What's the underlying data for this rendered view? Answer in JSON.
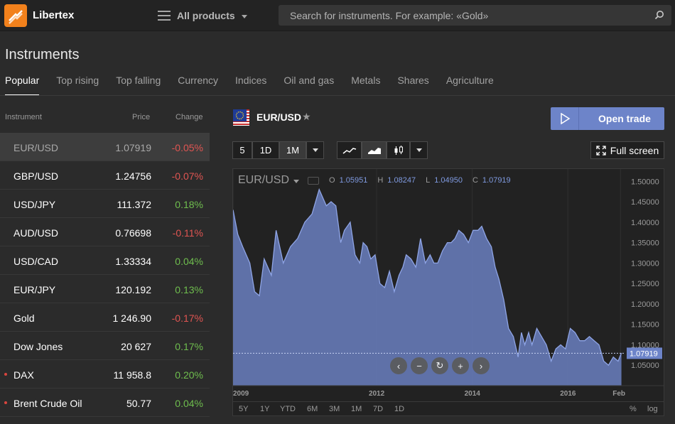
{
  "app": {
    "brand": "Libertex",
    "menu_label": "All products",
    "search_placeholder": "Search for instruments. For example: «Gold»"
  },
  "page": {
    "title": "Instruments",
    "tabs": [
      "Popular",
      "Top rising",
      "Top falling",
      "Currency",
      "Indices",
      "Oil and gas",
      "Metals",
      "Shares",
      "Agriculture"
    ],
    "active_tab": "Popular"
  },
  "table": {
    "headers": {
      "instrument": "Instrument",
      "price": "Price",
      "change": "Change"
    },
    "rows": [
      {
        "name": "EUR/USD",
        "price": "1.07919",
        "change": "-0.05%",
        "direction": "down",
        "selected": true,
        "dot": false
      },
      {
        "name": "GBP/USD",
        "price": "1.24756",
        "change": "-0.07%",
        "direction": "down",
        "selected": false,
        "dot": false
      },
      {
        "name": "USD/JPY",
        "price": "111.372",
        "change": "0.18%",
        "direction": "up",
        "selected": false,
        "dot": false
      },
      {
        "name": "AUD/USD",
        "price": "0.76698",
        "change": "-0.11%",
        "direction": "down",
        "selected": false,
        "dot": false
      },
      {
        "name": "USD/CAD",
        "price": "1.33334",
        "change": "0.04%",
        "direction": "up",
        "selected": false,
        "dot": false
      },
      {
        "name": "EUR/JPY",
        "price": "120.192",
        "change": "0.13%",
        "direction": "up",
        "selected": false,
        "dot": false
      },
      {
        "name": "Gold",
        "price": "1 246.90",
        "change": "-0.17%",
        "direction": "down",
        "selected": false,
        "dot": false
      },
      {
        "name": "Dow Jones",
        "price": "20 627",
        "change": "0.17%",
        "direction": "up",
        "selected": false,
        "dot": false
      },
      {
        "name": "DAX",
        "price": "11 958.8",
        "change": "0.20%",
        "direction": "up",
        "selected": false,
        "dot": true
      },
      {
        "name": "Brent Crude Oil",
        "price": "50.77",
        "change": "0.04%",
        "direction": "up",
        "selected": false,
        "dot": true
      }
    ]
  },
  "instrument": {
    "symbol": "EUR/USD",
    "open_trade_label": "Open trade",
    "full_screen_label": "Full screen",
    "interval_buttons": [
      "5",
      "1D",
      "1M"
    ],
    "active_interval": "1M",
    "chart_type_icons": [
      "line-chart-icon",
      "area-chart-icon",
      "candlestick-icon"
    ],
    "active_chart_type": "area-chart-icon"
  },
  "ohlc": {
    "symbol": "EUR/USD",
    "o_label": "O",
    "o": "1.05951",
    "h_label": "H",
    "h": "1.08247",
    "l_label": "L",
    "l": "1.04950",
    "c_label": "C",
    "c": "1.07919"
  },
  "ranges": [
    "5Y",
    "1Y",
    "YTD",
    "6M",
    "3M",
    "1M",
    "7D",
    "1D"
  ],
  "scale_options": [
    "%",
    "log"
  ],
  "colors": {
    "accent": "#6d84c9",
    "area_fill": "#6a7fbf",
    "area_line": "#8fa5e6",
    "positive": "#6fbe4e",
    "negative": "#e05552",
    "brand": "#f2811c"
  },
  "chart_data": {
    "type": "area",
    "title": "EUR/USD",
    "xlabel": "",
    "ylabel": "",
    "x_tick_labels": [
      "2009",
      "2012",
      "2014",
      "2016",
      "Feb"
    ],
    "x_ticks": [
      2009,
      2012,
      2014,
      2016,
      2017.1
    ],
    "y_ticks": [
      1.05,
      1.1,
      1.15,
      1.2,
      1.25,
      1.3,
      1.35,
      1.4,
      1.45,
      1.5
    ],
    "y_tick_labels": [
      "1.05000",
      "1.10000",
      "1.15000",
      "1.20000",
      "1.25000",
      "1.30000",
      "1.35000",
      "1.40000",
      "1.45000",
      "1.50000"
    ],
    "xlim": [
      2009,
      2017.2
    ],
    "ylim": [
      1.0,
      1.53
    ],
    "current_value": 1.07919,
    "current_label": "1.07919",
    "x": [
      2009.0,
      2009.1,
      2009.2,
      2009.35,
      2009.45,
      2009.55,
      2009.65,
      2009.8,
      2009.9,
      2010.05,
      2010.2,
      2010.35,
      2010.5,
      2010.65,
      2010.8,
      2010.95,
      2011.05,
      2011.15,
      2011.25,
      2011.33,
      2011.45,
      2011.55,
      2011.65,
      2011.72,
      2011.8,
      2011.88,
      2011.97,
      2012.07,
      2012.17,
      2012.27,
      2012.37,
      2012.47,
      2012.55,
      2012.62,
      2012.72,
      2012.82,
      2012.92,
      2013.02,
      2013.12,
      2013.2,
      2013.28,
      2013.38,
      2013.48,
      2013.56,
      2013.64,
      2013.72,
      2013.82,
      2013.92,
      2014.02,
      2014.12,
      2014.2,
      2014.3,
      2014.4,
      2014.48,
      2014.56,
      2014.66,
      2014.76,
      2014.86,
      2014.96,
      2015.03,
      2015.1,
      2015.18,
      2015.25,
      2015.35,
      2015.45,
      2015.55,
      2015.65,
      2015.75,
      2015.85,
      2015.95,
      2016.05,
      2016.15,
      2016.25,
      2016.35,
      2016.45,
      2016.55,
      2016.65,
      2016.75,
      2016.85,
      2016.95,
      2017.05,
      2017.12
    ],
    "y": [
      1.43,
      1.37,
      1.34,
      1.3,
      1.23,
      1.22,
      1.31,
      1.27,
      1.38,
      1.3,
      1.34,
      1.36,
      1.4,
      1.42,
      1.48,
      1.44,
      1.45,
      1.44,
      1.35,
      1.38,
      1.4,
      1.32,
      1.3,
      1.35,
      1.34,
      1.31,
      1.32,
      1.25,
      1.24,
      1.28,
      1.23,
      1.27,
      1.29,
      1.32,
      1.31,
      1.29,
      1.36,
      1.3,
      1.32,
      1.3,
      1.3,
      1.33,
      1.35,
      1.35,
      1.36,
      1.38,
      1.37,
      1.35,
      1.38,
      1.38,
      1.39,
      1.36,
      1.34,
      1.29,
      1.26,
      1.21,
      1.14,
      1.12,
      1.07,
      1.13,
      1.1,
      1.13,
      1.1,
      1.14,
      1.12,
      1.1,
      1.06,
      1.09,
      1.1,
      1.09,
      1.14,
      1.13,
      1.11,
      1.11,
      1.12,
      1.11,
      1.1,
      1.06,
      1.05,
      1.07,
      1.06,
      1.08
    ]
  }
}
